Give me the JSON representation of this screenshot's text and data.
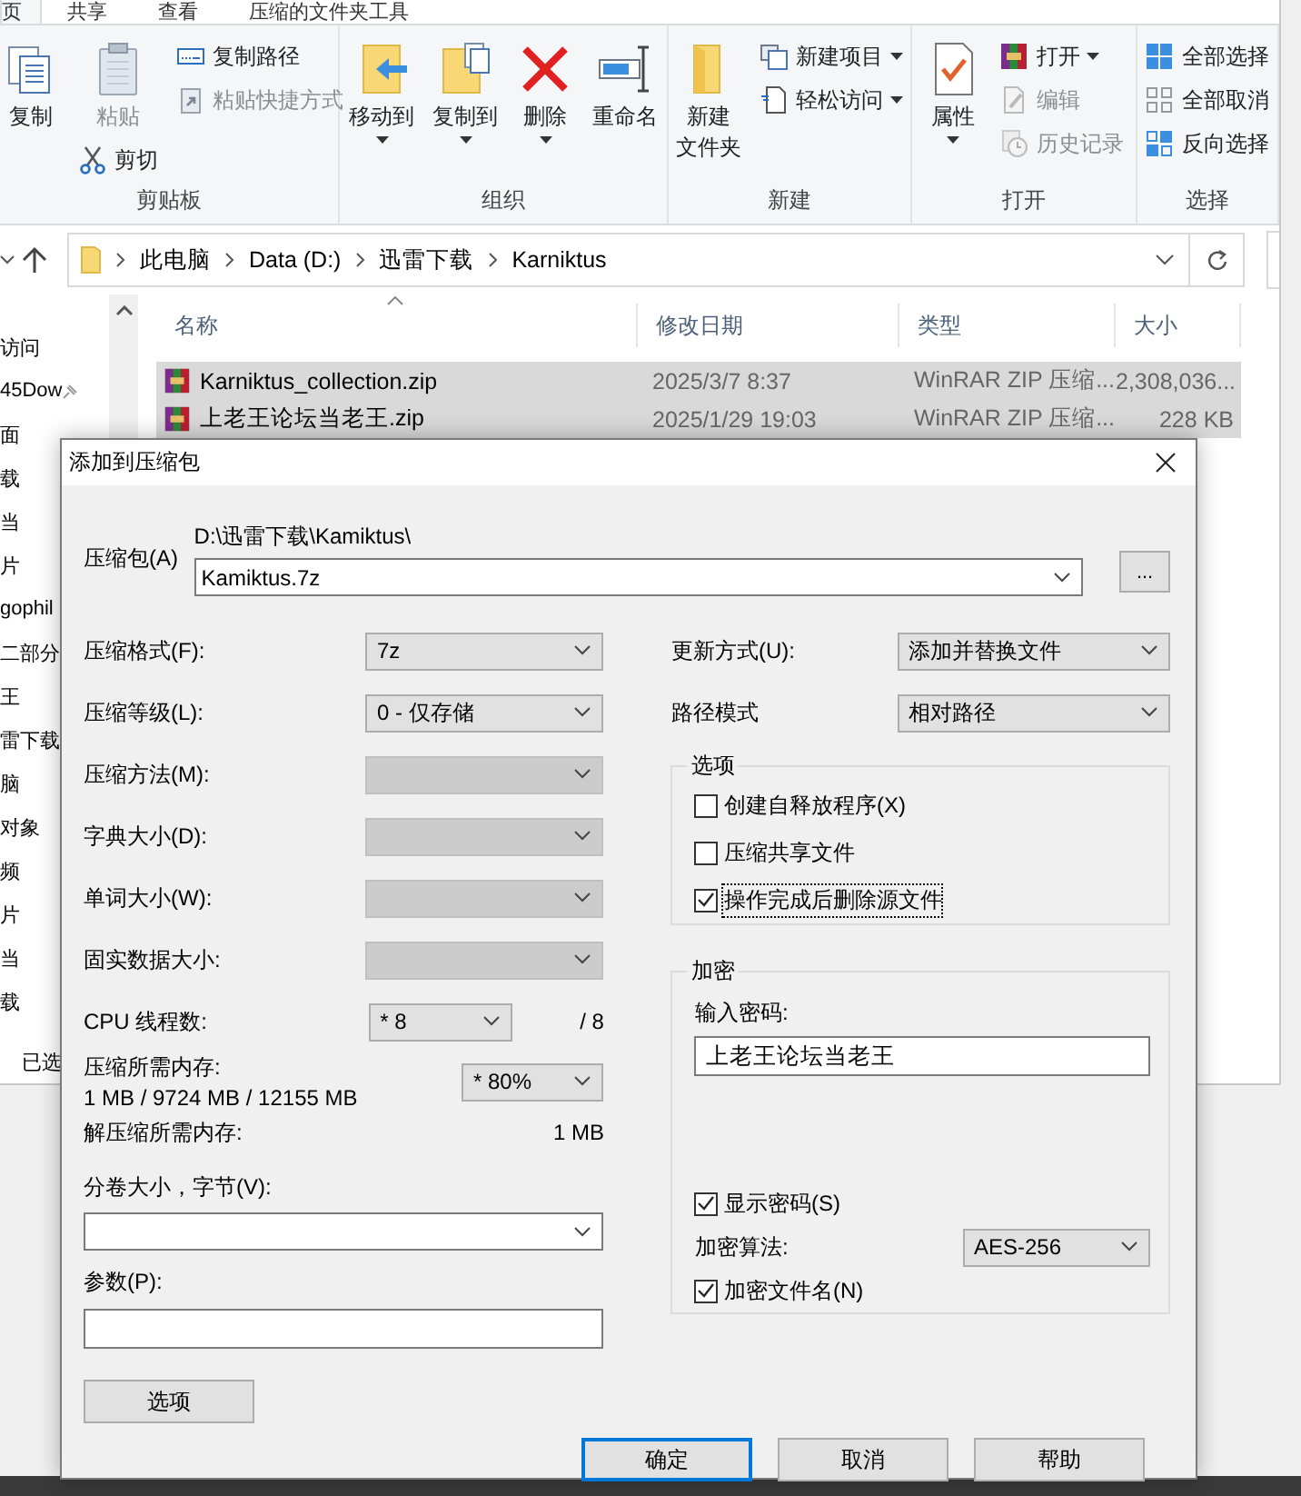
{
  "explorer": {
    "tabs": [
      {
        "label": "页",
        "selected": true
      },
      {
        "label": "共享",
        "selected": false
      },
      {
        "label": "查看",
        "selected": false
      },
      {
        "label": "压缩的文件夹工具",
        "selected": false
      }
    ],
    "ribbon": [
      {
        "label": "剪贴板",
        "columns": [
          {
            "items": [
              {
                "kind": "large",
                "label": "复制",
                "disabled": false,
                "menu": false
              }
            ]
          },
          {
            "items": [
              {
                "kind": "large",
                "label": "粘贴",
                "disabled": true,
                "menu": false
              },
              {
                "kind": "small",
                "label": "剪切",
                "disabled": false,
                "menu": false
              }
            ]
          },
          {
            "items": [
              {
                "kind": "small",
                "label": "复制路径",
                "disabled": false,
                "menu": false
              },
              {
                "kind": "small",
                "label": "粘贴快捷方式",
                "disabled": true,
                "menu": false
              }
            ]
          }
        ]
      },
      {
        "label": "组织",
        "columns": [
          {
            "items": [
              {
                "kind": "large",
                "label": "移动到",
                "disabled": false,
                "menu": true
              }
            ]
          },
          {
            "items": [
              {
                "kind": "large",
                "label": "复制到",
                "disabled": false,
                "menu": true
              }
            ]
          },
          {
            "items": [
              {
                "kind": "large",
                "label": "删除",
                "disabled": false,
                "menu": true
              }
            ]
          },
          {
            "items": [
              {
                "kind": "large",
                "label": "重命名",
                "disabled": false,
                "menu": false
              }
            ]
          }
        ]
      },
      {
        "label": "新建",
        "columns": [
          {
            "items": [
              {
                "kind": "large",
                "label": "新建",
                "label_line2": "文件夹",
                "disabled": false,
                "menu": false
              }
            ]
          },
          {
            "items": [
              {
                "kind": "small",
                "label": "新建项目",
                "disabled": false,
                "menu": true
              },
              {
                "kind": "small",
                "label": "轻松访问",
                "disabled": false,
                "menu": true
              }
            ]
          }
        ]
      },
      {
        "label": "打开",
        "columns": [
          {
            "items": [
              {
                "kind": "large",
                "label": "属性",
                "disabled": false,
                "menu": true
              }
            ]
          },
          {
            "items": [
              {
                "kind": "small",
                "label": "打开",
                "disabled": false,
                "menu": true
              },
              {
                "kind": "small",
                "label": "编辑",
                "disabled": true,
                "menu": false
              },
              {
                "kind": "small",
                "label": "历史记录",
                "disabled": true,
                "menu": false
              }
            ]
          }
        ]
      },
      {
        "label": "选择",
        "columns": [
          {
            "items": [
              {
                "kind": "small",
                "label": "全部选择",
                "disabled": false,
                "menu": false
              },
              {
                "kind": "small",
                "label": "全部取消",
                "disabled": false,
                "menu": false
              },
              {
                "kind": "small",
                "label": "反向选择",
                "disabled": false,
                "menu": false
              }
            ]
          }
        ]
      }
    ],
    "breadcrumbs": [
      "此电脑",
      "Data (D:)",
      "迅雷下载",
      "Karniktus"
    ],
    "nav": [
      {
        "label": "访问"
      },
      {
        "label": "45Dow",
        "pinned": true
      },
      {
        "label": "面"
      },
      {
        "label": "载"
      },
      {
        "label": "当"
      },
      {
        "label": "片"
      },
      {
        "label": "gophil"
      },
      {
        "label": "二部分"
      },
      {
        "label": "王"
      },
      {
        "label": "雷下载"
      },
      {
        "label": "脑"
      },
      {
        "label": "对象"
      },
      {
        "label": "频"
      },
      {
        "label": "片"
      },
      {
        "label": "当"
      },
      {
        "label": "载"
      }
    ],
    "columns": [
      "名称",
      "修改日期",
      "类型",
      "大小"
    ],
    "files": [
      {
        "name": "Karniktus_collection.zip",
        "date": "2025/3/7 8:37",
        "type": "WinRAR ZIP 压缩...",
        "size": "2,308,036...",
        "selected": true
      },
      {
        "name": "上老王论坛当老王.zip",
        "date": "2025/1/29 19:03",
        "type": "WinRAR ZIP 压缩...",
        "size": "228 KB",
        "selected": true
      }
    ],
    "status": "已选"
  },
  "dialog": {
    "title": "添加到压缩包",
    "archive": {
      "label": "压缩包(A)",
      "path": "D:\\迅雷下载\\Kamiktus\\",
      "value": "Kamiktus.7z",
      "browse": "..."
    },
    "left_fields": [
      {
        "kind": "select",
        "label": "压缩格式(F):",
        "value": "7z",
        "disabled": false
      },
      {
        "kind": "select",
        "label": "压缩等级(L):",
        "value": "0 - 仅存储",
        "disabled": false
      },
      {
        "kind": "select",
        "label": "压缩方法(M):",
        "disabled": true
      },
      {
        "kind": "select",
        "label": "字典大小(D):",
        "disabled": true
      },
      {
        "kind": "select",
        "label": "单词大小(W):",
        "disabled": true
      },
      {
        "kind": "select",
        "label": "固实数据大小:",
        "disabled": true
      },
      {
        "kind": "threads",
        "label": "CPU 线程数:",
        "value": "* 8",
        "suffix": "/ 8"
      },
      {
        "kind": "memory",
        "label": "压缩所需内存:",
        "detail": "1 MB / 9724 MB / 12155 MB",
        "value": "* 80%"
      },
      {
        "kind": "info",
        "label": "解压缩所需内存:",
        "value": "1 MB"
      },
      {
        "kind": "combo",
        "label": "分卷大小，字节(V):"
      },
      {
        "kind": "input",
        "label": "参数(P):"
      }
    ],
    "options_button": "选项",
    "right_fields": [
      {
        "kind": "select",
        "label": "更新方式(U):",
        "value": "添加并替换文件",
        "disabled": false
      },
      {
        "kind": "select",
        "label": "路径模式",
        "value": "相对路径",
        "disabled": false
      }
    ],
    "options_group": {
      "title": "选项",
      "checkboxes": [
        {
          "label": "创建自释放程序(X)",
          "checked": false,
          "focused": false
        },
        {
          "label": "压缩共享文件",
          "checked": false,
          "focused": false
        },
        {
          "label": "操作完成后删除源文件",
          "checked": true,
          "focused": true
        }
      ]
    },
    "encryption": {
      "title": "加密",
      "password_label": "输入密码:",
      "password": "上老王论坛当老王",
      "show_password": {
        "label": "显示密码(S)",
        "checked": true
      },
      "method_label": "加密算法:",
      "method": "AES-256",
      "encrypt_names": {
        "label": "加密文件名(N)",
        "checked": true
      }
    },
    "buttons": [
      {
        "label": "确定",
        "default": true
      },
      {
        "label": "取消",
        "default": false
      },
      {
        "label": "帮助",
        "default": false
      }
    ]
  }
}
